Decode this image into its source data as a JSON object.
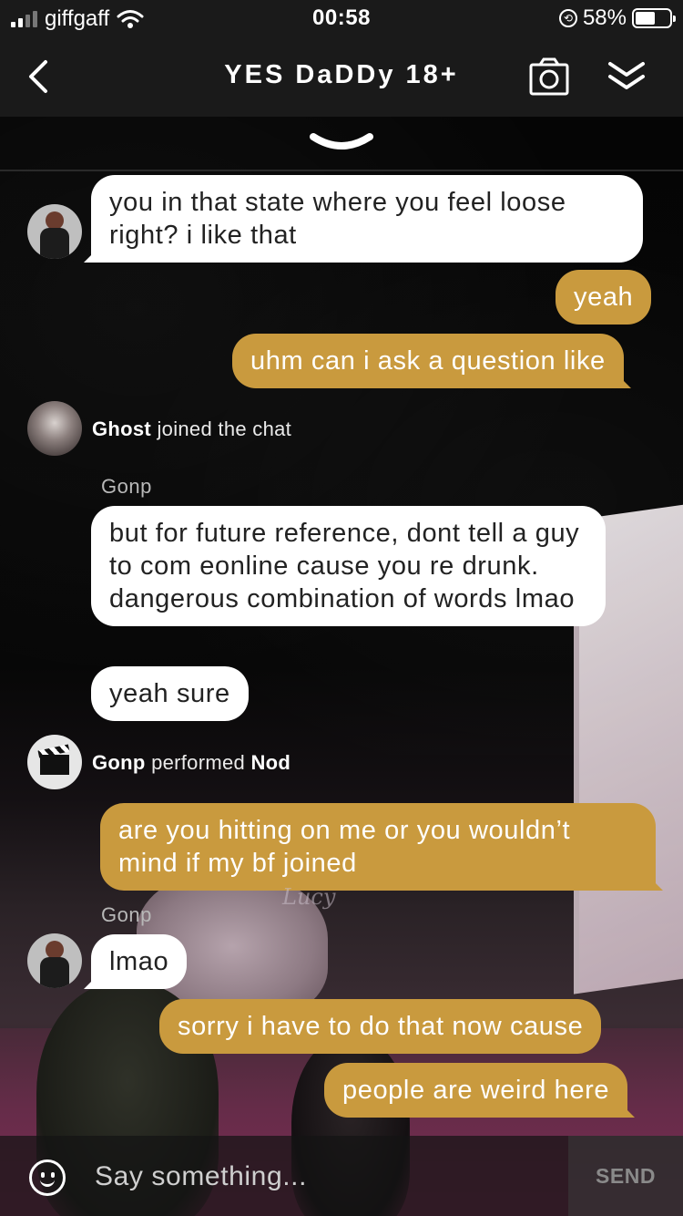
{
  "status_bar": {
    "carrier": "giffgaff",
    "time": "00:58",
    "battery_percent": "58%",
    "battery_level": 0.58
  },
  "header": {
    "title": "YES DaDDy 18+",
    "back_icon": "chevron-left-icon",
    "camera_icon": "camera-icon",
    "collapse_icon": "double-chevron-down-icon"
  },
  "colors": {
    "outgoing_bubble": "#c99a3e",
    "incoming_bubble": "#ffffff",
    "header_bg": "#1a1a1a"
  },
  "messages": [
    {
      "type": "incoming",
      "text": "you in that state where you feel loose right? i like that"
    },
    {
      "type": "outgoing",
      "text": "yeah"
    },
    {
      "type": "outgoing",
      "text": "uhm can i ask a question like"
    },
    {
      "type": "system",
      "name": "Ghost",
      "action": "joined the chat"
    },
    {
      "type": "sender",
      "name": "Gonp"
    },
    {
      "type": "incoming",
      "text": "but for future reference, dont tell a guy to com eonline cause you re drunk. dangerous combination of words lmao"
    },
    {
      "type": "incoming",
      "text": "yeah sure"
    },
    {
      "type": "system",
      "name": "Gonp",
      "action": "performed",
      "object": "Nod"
    },
    {
      "type": "outgoing",
      "text": "are you hitting on me or you wouldn’t mind if my bf joined"
    },
    {
      "type": "sender",
      "name": "Gonp"
    },
    {
      "type": "incoming",
      "text": "lmao"
    },
    {
      "type": "outgoing",
      "text": "sorry i have to do that now cause"
    },
    {
      "type": "outgoing",
      "text": "people are weird here"
    }
  ],
  "watermark": "Lucy",
  "input": {
    "placeholder": "Say something...",
    "value": "",
    "send_label": "SEND",
    "emoji_icon": "smiley-icon"
  }
}
